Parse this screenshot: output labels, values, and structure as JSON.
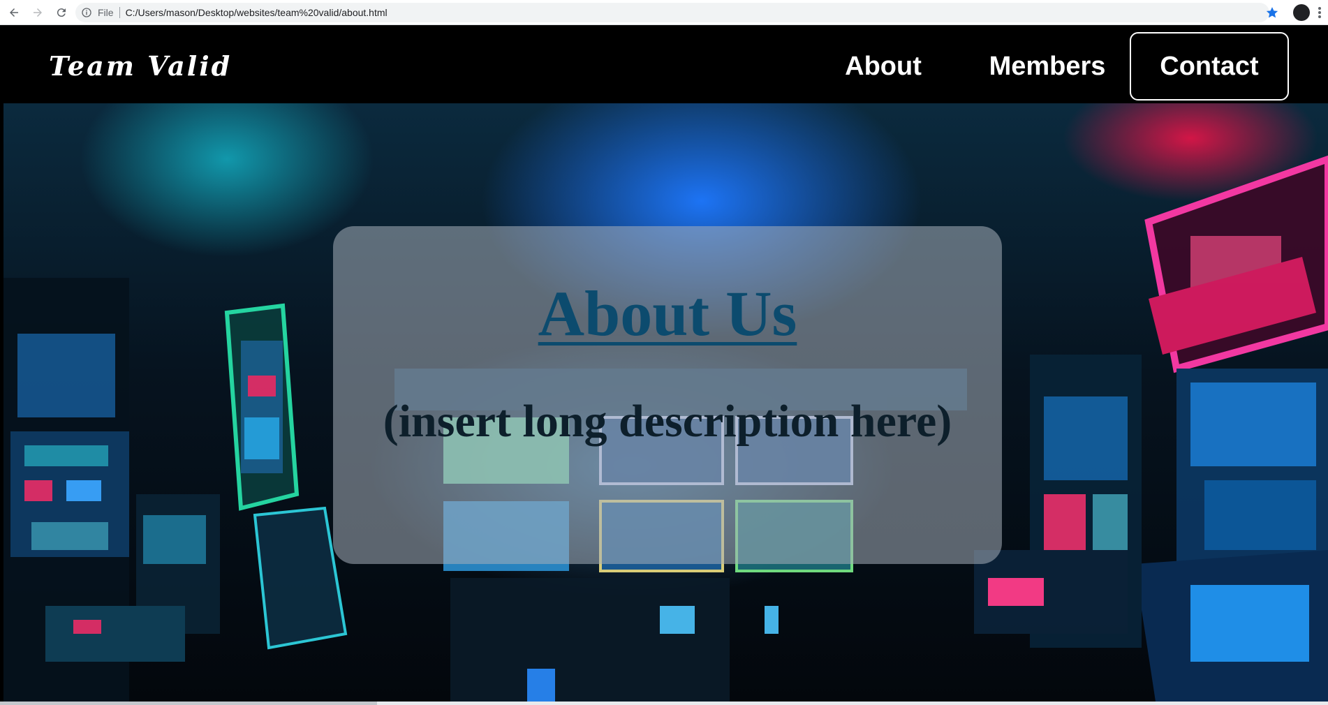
{
  "browser": {
    "scheme_label": "File",
    "url": "C:/Users/mason/Desktop/websites/team%20valid/about.html",
    "icons": [
      "back-icon",
      "forward-icon",
      "reload-icon",
      "info-icon",
      "star-icon",
      "profile-avatar",
      "menu-icon"
    ],
    "star_color": "#1a73e8"
  },
  "header": {
    "logo": "Team Valid",
    "nav": [
      {
        "label": "About"
      },
      {
        "label": "Members"
      },
      {
        "label": "Contact"
      }
    ]
  },
  "main": {
    "title": "About Us",
    "description": "(insert long description here)"
  },
  "colors": {
    "header_bg": "#000000",
    "title_color": "#0c4b6e",
    "desc_color": "#0d1f2b"
  }
}
